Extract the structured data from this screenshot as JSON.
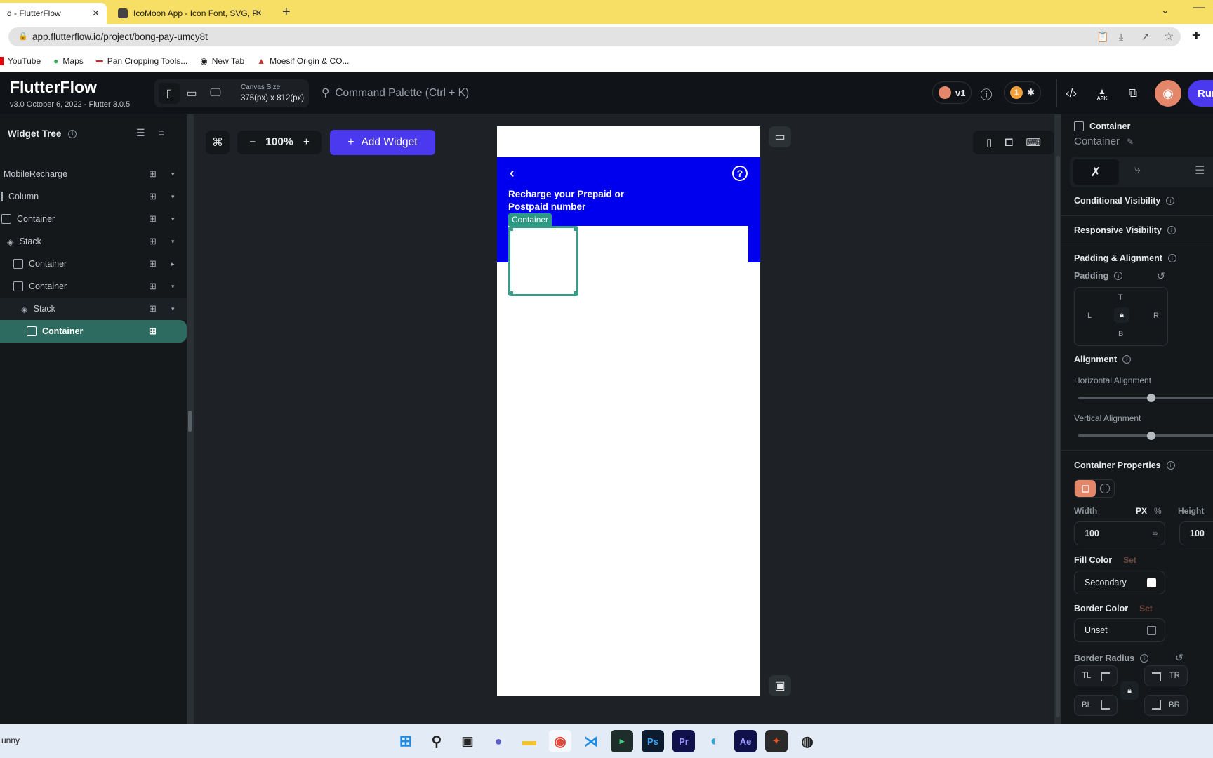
{
  "browser": {
    "tabs": [
      {
        "label": "d - FlutterFlow",
        "active": true
      },
      {
        "label": "IcoMoon App - Icon Font, SVG, P",
        "active": false
      }
    ],
    "new_tab_label": "+",
    "url": "app.flutterflow.io/project/bong-pay-umcy8t",
    "bookmarks": [
      "YouTube",
      "Maps",
      "Pan Cropping Tools...",
      "New Tab",
      "Moesif Origin & CO..."
    ]
  },
  "header": {
    "brand": "FlutterFlow",
    "version": "v3.0 October 6, 2022 - Flutter 3.0.5",
    "canvas_size_label": "Canvas Size",
    "canvas_size_value": "375(px) x 812(px)",
    "command_palette": "Command Palette (Ctrl + K)",
    "version_badge": "v1",
    "notification_count": "1",
    "apk_label": "APK",
    "run_label": "Run"
  },
  "widget_tree": {
    "title": "Widget Tree",
    "items": [
      {
        "label": "MobileRecharge",
        "icon": "none",
        "caret": "▾"
      },
      {
        "label": "Column",
        "icon": "column-icon",
        "caret": "▾"
      },
      {
        "label": "Container",
        "icon": "container-icon",
        "caret": "▾"
      },
      {
        "label": "Stack",
        "icon": "stack-icon",
        "caret": "▾"
      },
      {
        "label": "Container",
        "icon": "container-icon",
        "caret": "▸"
      },
      {
        "label": "Container",
        "icon": "container-icon",
        "caret": "▾"
      },
      {
        "label": "Stack",
        "icon": "stack-icon",
        "caret": "▾"
      },
      {
        "label": "Container",
        "icon": "container-icon",
        "caret": "",
        "selected": true
      }
    ]
  },
  "canvas": {
    "zoom_level": "100%",
    "zoom_out": "−",
    "zoom_in": "+",
    "add_widget": "Add Widget",
    "phone": {
      "headline": "Recharge your Prepaid or Postpaid number",
      "selected_tag": "Container",
      "band_color": "#0000ee"
    }
  },
  "properties": {
    "widget_type": "Container",
    "widget_name": "Container",
    "conditional_visibility": "Conditional Visibility",
    "responsive_visibility": "Responsive Visibility",
    "padding_alignment": "Padding & Alignment",
    "padding_label": "Padding",
    "padding_sides": {
      "t": "T",
      "l": "L",
      "r": "R",
      "b": "B"
    },
    "alignment_label": "Alignment",
    "horizontal_alignment": "Horizontal Alignment",
    "horizontal_alignment_value": 0.0,
    "vertical_alignment": "Vertical Alignment",
    "vertical_alignment_value": 0.0,
    "container_properties": "Container Properties",
    "width_label": "Width",
    "unit_px": "PX",
    "unit_pct": "%",
    "width_value": "100",
    "height_label": "Height",
    "height_value": "100",
    "fill_color_label": "Fill Color",
    "set_label": "Set",
    "fill_color_value": "Secondary",
    "border_color_label": "Border Color",
    "border_color_value": "Unset",
    "border_radius_label": "Border Radius",
    "radius_corners": {
      "tl": "TL",
      "tr": "TR",
      "bl": "BL",
      "br": "BR"
    }
  },
  "taskbar": {
    "weather_text": "unny",
    "apps": [
      "Start",
      "Search",
      "Task View",
      "Teams",
      "File Explorer",
      "Chrome",
      "VS Code",
      "Terminal",
      "Photoshop",
      "Premiere Pro",
      "Edge Beta",
      "After Effects",
      "Figma",
      "OBS"
    ]
  },
  "colors": {
    "accent": "#4b39ef",
    "selection": "#2d6b61",
    "preview_button": "#e3866a",
    "badge_orange": "#f2a03c"
  }
}
